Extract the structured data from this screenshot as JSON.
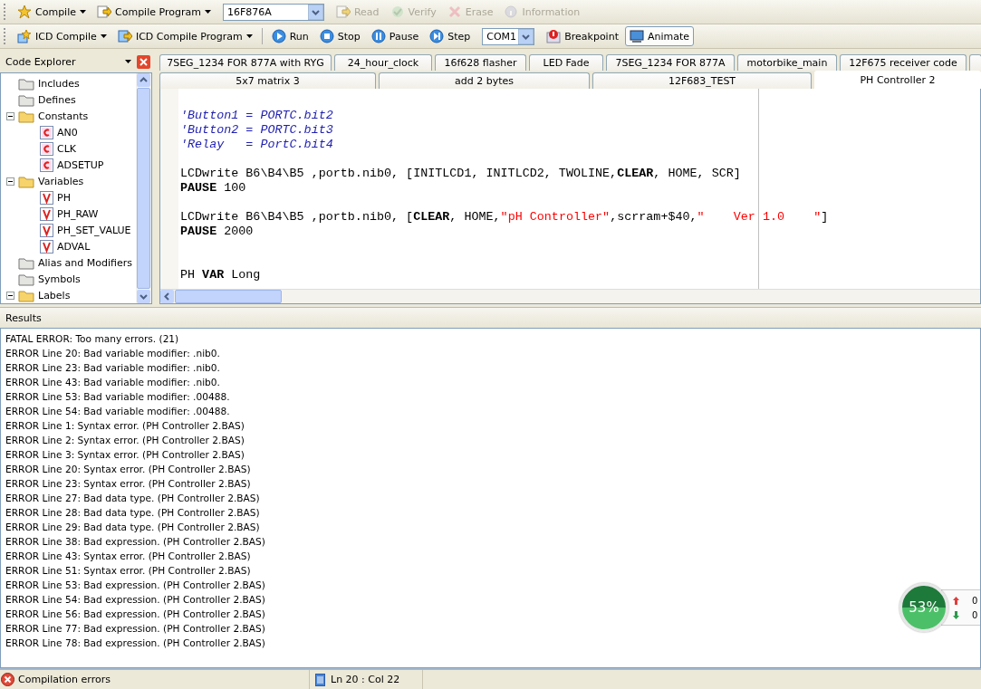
{
  "toolbars": [
    {
      "items": [
        {
          "kind": "button",
          "label": "Compile",
          "dropdown": true,
          "disabled": false
        },
        {
          "kind": "button",
          "label": "Compile Program",
          "dropdown": true,
          "disabled": false
        },
        {
          "kind": "combo",
          "value": "16F876A"
        },
        {
          "kind": "button",
          "label": "Read",
          "dropdown": false,
          "disabled": true
        },
        {
          "kind": "button",
          "label": "Verify",
          "dropdown": false,
          "disabled": true
        },
        {
          "kind": "button",
          "label": "Erase",
          "dropdown": false,
          "disabled": true
        },
        {
          "kind": "button",
          "label": "Information",
          "dropdown": false,
          "disabled": true
        }
      ]
    },
    {
      "items": [
        {
          "kind": "button",
          "label": "ICD Compile",
          "dropdown": true,
          "disabled": false
        },
        {
          "kind": "button",
          "label": "ICD Compile Program",
          "dropdown": true,
          "disabled": false
        },
        {
          "kind": "button",
          "label": "Run",
          "dropdown": false,
          "disabled": false
        },
        {
          "kind": "button",
          "label": "Stop",
          "dropdown": false,
          "disabled": false
        },
        {
          "kind": "button",
          "label": "Pause",
          "dropdown": false,
          "disabled": false
        },
        {
          "kind": "button",
          "label": "Step",
          "dropdown": false,
          "disabled": false
        },
        {
          "kind": "combo",
          "value": "COM1"
        },
        {
          "kind": "button",
          "label": "Breakpoint",
          "dropdown": false,
          "disabled": false
        },
        {
          "kind": "button",
          "label": "Animate",
          "dropdown": false,
          "disabled": false,
          "pressed": true
        }
      ]
    }
  ],
  "code_explorer": {
    "title": "Code Explorer",
    "items": [
      {
        "label": "Includes",
        "kind": "folder"
      },
      {
        "label": "Defines",
        "kind": "folder"
      },
      {
        "label": "Constants",
        "kind": "folder",
        "expanded": true,
        "children": [
          {
            "label": "AN0",
            "kind": "constant"
          },
          {
            "label": "CLK",
            "kind": "constant"
          },
          {
            "label": "ADSETUP",
            "kind": "constant"
          }
        ]
      },
      {
        "label": "Variables",
        "kind": "folder",
        "expanded": true,
        "children": [
          {
            "label": "PH",
            "kind": "variable"
          },
          {
            "label": "PH_RAW",
            "kind": "variable"
          },
          {
            "label": "PH_SET_VALUE",
            "kind": "variable"
          },
          {
            "label": "ADVAL",
            "kind": "variable"
          }
        ]
      },
      {
        "label": "Alias and Modifiers",
        "kind": "folder"
      },
      {
        "label": "Symbols",
        "kind": "folder"
      },
      {
        "label": "Labels",
        "kind": "folder",
        "expanded": true
      }
    ]
  },
  "tabs": [
    [
      {
        "label": "7SEG_1234 FOR 877A with RYG",
        "selected": false
      },
      {
        "label": "24_hour_clock",
        "selected": false
      },
      {
        "label": "16f628 flasher",
        "selected": false
      },
      {
        "label": "LED Fade",
        "selected": false
      },
      {
        "label": "7SEG_1234 FOR 877A",
        "selected": false
      },
      {
        "label": "motorbike_main",
        "selected": false
      },
      {
        "label": "12F675 receiver code",
        "selected": false
      }
    ],
    [
      {
        "label": "5x7 matrix 3",
        "selected": false
      },
      {
        "label": "add 2 bytes",
        "selected": false
      },
      {
        "label": "12F683_TEST",
        "selected": false
      },
      {
        "label": "PH Controller 2",
        "selected": true
      }
    ]
  ],
  "editor": {
    "lines": [
      {
        "kind": "blank"
      },
      [
        {
          "kind": "comment",
          "text": "'Button1 = PORTC.bit2"
        }
      ],
      [
        {
          "kind": "comment",
          "text": "'Button2 = PORTC.bit3"
        }
      ],
      [
        {
          "kind": "comment",
          "text": "'Relay   = PortC.bit4"
        }
      ],
      {
        "kind": "blank"
      },
      [
        {
          "kind": "plain",
          "text": "LCDwrite B6\\B4\\B5 ,portb.nib0, [INITLCD1, INITLCD2, TWOLINE,"
        },
        {
          "kind": "keyword",
          "text": "CLEAR"
        },
        {
          "kind": "plain",
          "text": ", HOME, SCR]"
        }
      ],
      [
        {
          "kind": "keyword",
          "text": "PAUSE"
        },
        {
          "kind": "plain",
          "text": " 100"
        }
      ],
      {
        "kind": "blank"
      },
      [
        {
          "kind": "plain",
          "text": "LCDwrite B6\\B4\\B5 ,portb.nib0, ["
        },
        {
          "kind": "keyword",
          "text": "CLEAR"
        },
        {
          "kind": "plain",
          "text": ", HOME,"
        },
        {
          "kind": "string",
          "text": "\"pH Controller\""
        },
        {
          "kind": "plain",
          "text": ",scrram+$40,"
        },
        {
          "kind": "string",
          "text": "\"    Ver 1.0    \""
        },
        {
          "kind": "plain",
          "text": "]"
        }
      ],
      [
        {
          "kind": "keyword",
          "text": "PAUSE"
        },
        {
          "kind": "plain",
          "text": " 2000"
        }
      ],
      {
        "kind": "blank"
      },
      {
        "kind": "blank"
      },
      [
        {
          "kind": "plain",
          "text": "PH "
        },
        {
          "kind": "keyword",
          "text": "VAR"
        },
        {
          "kind": "plain",
          "text": " Long"
        }
      ]
    ]
  },
  "results": {
    "title": "Results",
    "lines": [
      "FATAL ERROR: Too many errors. (21)",
      "ERROR Line 20: Bad variable modifier: .nib0.",
      "ERROR Line 23: Bad variable modifier: .nib0.",
      "ERROR Line 43: Bad variable modifier: .nib0.",
      "ERROR Line 53: Bad variable modifier: .00488.",
      "ERROR Line 54: Bad variable modifier: .00488.",
      "ERROR Line 1: Syntax error. (PH Controller 2.BAS)",
      "ERROR Line 2: Syntax error. (PH Controller 2.BAS)",
      "ERROR Line 3: Syntax error. (PH Controller 2.BAS)",
      "ERROR Line 20: Syntax error. (PH Controller 2.BAS)",
      "ERROR Line 23: Syntax error. (PH Controller 2.BAS)",
      "ERROR Line 27: Bad data type. (PH Controller 2.BAS)",
      "ERROR Line 28: Bad data type. (PH Controller 2.BAS)",
      "ERROR Line 29: Bad data type. (PH Controller 2.BAS)",
      "ERROR Line 38: Bad expression. (PH Controller 2.BAS)",
      "ERROR Line 43: Syntax error. (PH Controller 2.BAS)",
      "ERROR Line 51: Syntax error. (PH Controller 2.BAS)",
      "ERROR Line 53: Bad expression. (PH Controller 2.BAS)",
      "ERROR Line 54: Bad expression. (PH Controller 2.BAS)",
      "ERROR Line 56: Bad expression. (PH Controller 2.BAS)",
      "ERROR Line 77: Bad expression. (PH Controller 2.BAS)",
      "ERROR Line 78: Bad expression. (PH Controller 2.BAS)"
    ]
  },
  "meter": {
    "reading": "53%",
    "rows": [
      {
        "kind": "up",
        "value": "0"
      },
      {
        "kind": "down",
        "value": "0"
      }
    ]
  },
  "status_bar": {
    "message": "Compilation errors",
    "position": "Ln 20 : Col 22"
  }
}
